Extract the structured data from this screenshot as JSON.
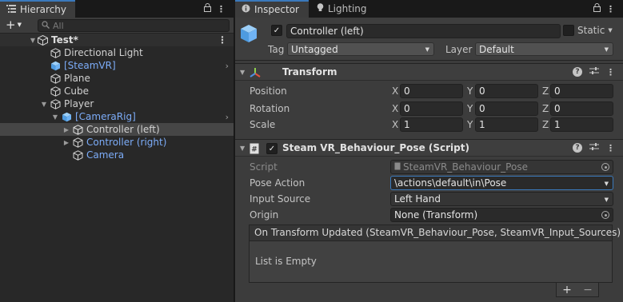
{
  "hierarchy": {
    "tab_label": "Hierarchy",
    "search_placeholder": "All",
    "scene_name": "Test*",
    "items": [
      {
        "label": "Directional Light",
        "prefab": false
      },
      {
        "label": "[SteamVR]",
        "prefab": true
      },
      {
        "label": "Plane",
        "prefab": false
      },
      {
        "label": "Cube",
        "prefab": false
      },
      {
        "label": "Player",
        "prefab": false
      },
      {
        "label": "[CameraRig]",
        "prefab": true
      },
      {
        "label": "Controller (left)",
        "prefab": false,
        "selected": true
      },
      {
        "label": "Controller (right)",
        "prefab": true
      },
      {
        "label": "Camera",
        "prefab": true
      }
    ]
  },
  "inspector": {
    "tabs": [
      "Inspector",
      "Lighting"
    ],
    "object_name": "Controller (left)",
    "static_label": "Static",
    "tag_label": "Tag",
    "tag_value": "Untagged",
    "layer_label": "Layer",
    "layer_value": "Default",
    "transform": {
      "title": "Transform",
      "rows": [
        {
          "label": "Position",
          "x": "0",
          "y": "0",
          "z": "0"
        },
        {
          "label": "Rotation",
          "x": "0",
          "y": "0",
          "z": "0"
        },
        {
          "label": "Scale",
          "x": "1",
          "y": "1",
          "z": "1"
        }
      ],
      "axes": [
        "X",
        "Y",
        "Z"
      ]
    },
    "script_component": {
      "title": "Steam VR_Behaviour_Pose (Script)",
      "script_label": "Script",
      "script_value": "SteamVR_Behaviour_Pose",
      "pose_action_label": "Pose Action",
      "pose_action_value": "\\actions\\default\\in\\Pose",
      "input_source_label": "Input Source",
      "input_source_value": "Left Hand",
      "origin_label": "Origin",
      "origin_value": "None (Transform)",
      "event_title": "On Transform Updated (SteamVR_Behaviour_Pose, SteamVR_Input_Sources)",
      "event_empty": "List is Empty",
      "add_symbol": "+",
      "remove_symbol": "−"
    }
  },
  "colors": {
    "accent": "#3a79bb",
    "prefab_text": "#7cacf8",
    "cube_icon": "#6fb3f4"
  }
}
